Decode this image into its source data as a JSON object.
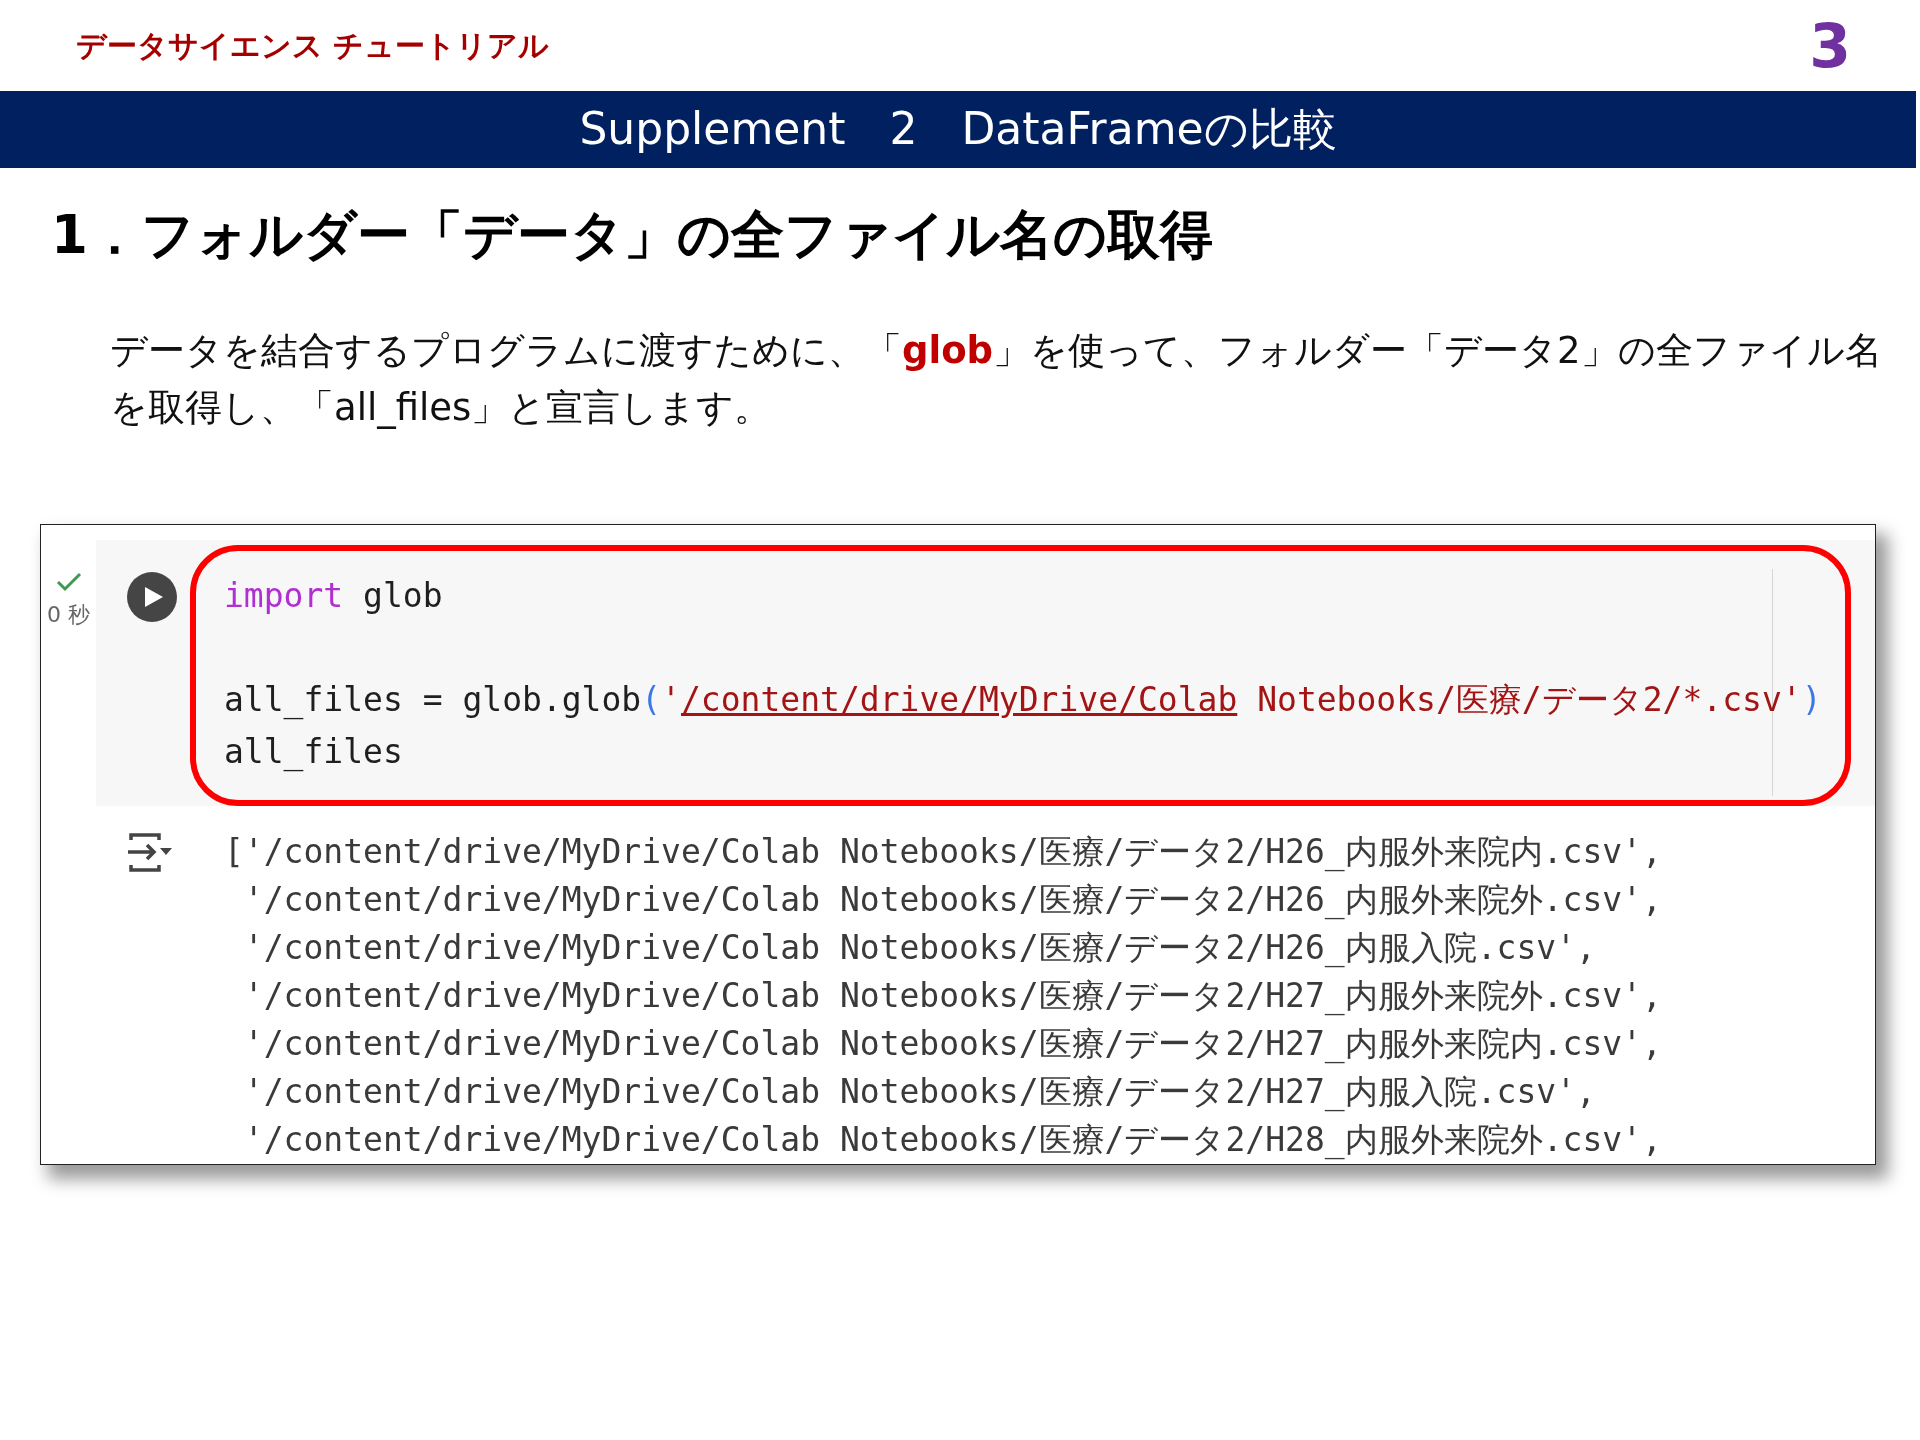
{
  "header": {
    "course_title": "データサイエンス チュートリアル",
    "page_number": "3"
  },
  "title_bar": {
    "title": "Supplement　2　DataFrameの比較"
  },
  "section": {
    "heading": "1．フォルダー「データ」の全ファイル名の取得",
    "paragraph": "データを結合するプログラムに渡すために、「**glob**」を使って、フォルダー「データ2」の全ファイル名を取得し、「all_files」と宣言します。"
  },
  "notebook": {
    "cell": {
      "completed": true,
      "duration": "0 秒",
      "highlighted": true,
      "code_lines": [
        {
          "kind": "code",
          "tokens": [
            {
              "kind": "keyword",
              "text": "import"
            },
            {
              "kind": "plain",
              "text": " glob"
            }
          ]
        },
        {
          "kind": "blank"
        },
        {
          "kind": "code",
          "tokens": [
            {
              "kind": "plain",
              "text": "all_files = glob.glob"
            },
            {
              "kind": "bracket",
              "text": "("
            },
            {
              "kind": "string",
              "text": "'"
            },
            {
              "kind": "link",
              "text": "/content/drive/MyDrive/Colab"
            },
            {
              "kind": "string",
              "text": " Notebooks/医療/データ2/*.csv'"
            },
            {
              "kind": "bracket",
              "text": ")"
            }
          ]
        },
        {
          "kind": "code",
          "tokens": [
            {
              "kind": "plain",
              "text": "all_files"
            }
          ]
        }
      ]
    },
    "output": {
      "lines": [
        "['/content/drive/MyDrive/Colab Notebooks/医療/データ2/H26_内服外来院内.csv',",
        "'/content/drive/MyDrive/Colab Notebooks/医療/データ2/H26_内服外来院外.csv',",
        "'/content/drive/MyDrive/Colab Notebooks/医療/データ2/H26_内服入院.csv',",
        "'/content/drive/MyDrive/Colab Notebooks/医療/データ2/H27_内服外来院外.csv',",
        "'/content/drive/MyDrive/Colab Notebooks/医療/データ2/H27_内服外来院内.csv',",
        "'/content/drive/MyDrive/Colab Notebooks/医療/データ2/H27_内服入院.csv',",
        "'/content/drive/MyDrive/Colab Notebooks/医療/データ2/H28_内服外来院外.csv',"
      ]
    }
  }
}
